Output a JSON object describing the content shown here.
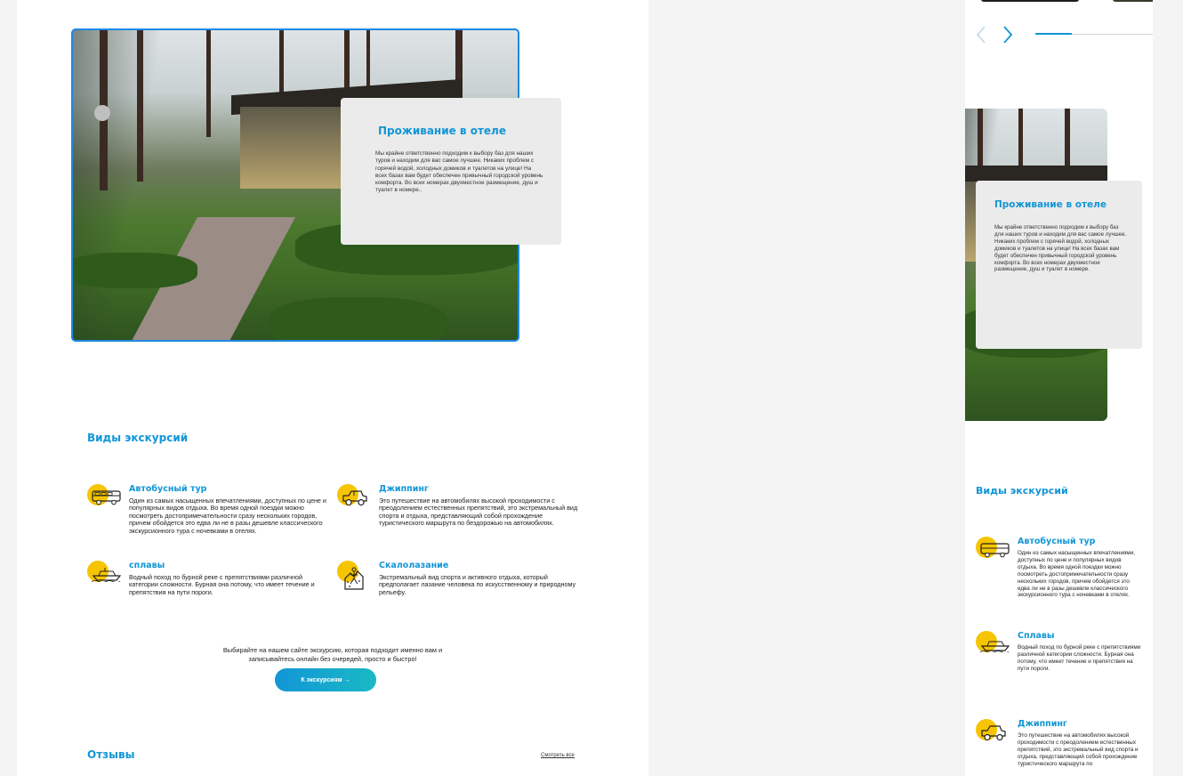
{
  "desktop": {
    "hotel_card": {
      "title": "Проживание в отеле",
      "text": "Мы крайне ответственно подходим к выбору баз для наших туров и находим для вас самое лучшее. Никаких проблем с горячей водой, холодных домиков и туалетов на улице! На всех базах вам будет обеспечен привычный городской уровень комфорта. Во всех номерах двухместное размещение, душ и туалет в номере.."
    },
    "excursions_title": "Виды экскурсий",
    "excursions": [
      {
        "icon": "bus-icon",
        "title": "Автобусный тур",
        "text": "Один из самых насыщенных впечатлениями, доступных по цене и популярных видов отдыха. Во время одной поездки можно посмотреть достопримечательности сразу нескольких городов, причем обойдется это едва ли не в разы дешевле классического экскурсионного тура с ночевками в отелях."
      },
      {
        "icon": "jeep-icon",
        "title": "Джиппинг",
        "text": "Это путешествие на автомобилях высокой проходимости с преодолением естественных препятствий, это экстремальный вид спорта и отдыха, представляющий собой прохождение туристического маршрута по бездорожью на автомобилях."
      },
      {
        "icon": "boat-icon",
        "title": "сплавы",
        "text": "Водный поход по бурной реке с препятствиями различной категории сложности. Бурная она потому, что имеет течение и препятствия на пути пороги."
      },
      {
        "icon": "climbing-icon",
        "title": "Скалолазание",
        "text": "Экстремальный вид спорта и активного отдыха, который предполагает лазание человека по искусственному и природному рельефу."
      }
    ],
    "cta_text": "Выбирайте на нашем сайте экскурсию, которая подходит именно вам и записывайтесь онлайн без очередей, просто и быстро!",
    "cta_button": "К экскурсиям →",
    "reviews_title": "Отзывы",
    "reviews_link": "Смотреть все"
  },
  "mobile": {
    "hotel_card": {
      "title": "Проживание в отеле",
      "text": "Мы крайне ответственно подходим к выбору баз для наших туров и находим для вас самое лучшее. Никаких проблем с горячей водой, холодных домиков и туалетов на улице! На всех базах вам будет обеспечен привычный городской уровень комфорта. Во всех номерах двухместное размещение, душ и туалет в номере."
    },
    "excursions_title": "Виды экскурсий",
    "excursions": [
      {
        "icon": "bus-icon",
        "title": "Автобусный тур",
        "text": "Один из самых насыщенных впечатлениями, доступных по цене и популярных видов отдыха. Во время одной поездки можно посмотреть достопримечательности сразу нескольких городов, причем обойдется это едва ли не в разы дешевле классического экскурсионного тура с ночевками в отелях."
      },
      {
        "icon": "boat-icon",
        "title": "Сплавы",
        "text": "Водный поход по бурной реке с препятствиями различной категории сложности. Бурная она потому, что имеет течение и препятствия на пути пороги."
      },
      {
        "icon": "jeep-icon",
        "title": "Джиппинг",
        "text": "Это путешествие на автомобилях высокой проходимости с преодолением естественных препятствий, это экстремальный вид спорта и отдыха, представляющий собой прохождение туристического маршрута по"
      }
    ],
    "slider": {
      "prev_icon": "chevron-left-icon",
      "next_icon": "chevron-right-icon",
      "progress": 0.33
    }
  },
  "colors": {
    "accent": "#1296d6",
    "icon_dot": "#f6c400",
    "card_bg": "#ebebeb"
  }
}
